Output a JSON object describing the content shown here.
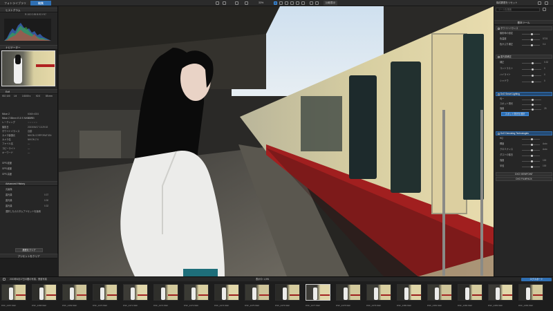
{
  "topbar": {
    "tab_library": "フォトライブラリ",
    "tab_edit": "編集",
    "zoom": "33%",
    "compare_label": "比較表示",
    "right_label": "構成履歴をリセット"
  },
  "left_panel": {
    "histogram": {
      "title": "ヒストグラム",
      "readout": "R:102 G:95 B:93 Y:97"
    },
    "navigator": {
      "title": "ナビゲーター",
      "zoom_label": "33%"
    },
    "exif": {
      "title": "Exif",
      "summary": [
        "ISO 100",
        "1/4",
        "1/1000 s",
        "f/2.0",
        "85 mm"
      ],
      "rows": [
        {
          "label": "Nikon Z",
          "value": "6048×4024"
        },
        {
          "label": "Nikon Z 85mm f/1.8 S NIKKOR",
          "value": "50 / 85"
        },
        {
          "label": "レーティング",
          "value": "☆☆☆☆☆"
        },
        {
          "label": "撮影日",
          "value": "2023/06/17 13:29:02"
        },
        {
          "label": "ホワイトバランス",
          "value": "自動"
        },
        {
          "label": "カメラ製造元",
          "value": "NIKON CORPORATION"
        },
        {
          "label": "カメラ名",
          "value": "NIKON Z 6"
        },
        {
          "label": "ファイル名",
          "value": "—"
        },
        {
          "label": "コピーライト",
          "value": "—"
        },
        {
          "label": "キーワード",
          "value": "—"
        }
      ],
      "gps": [
        {
          "label": "GPS 緯度",
          "value": ""
        },
        {
          "label": "GPS 経度",
          "value": ""
        },
        {
          "label": "GPS 高度",
          "value": ""
        }
      ]
    },
    "history": {
      "title": "Advanced History",
      "rows": [
        {
          "label": "元画像",
          "value": ""
        },
        {
          "label": "露光量",
          "value": "0.37"
        },
        {
          "label": "露光量",
          "value": "0.30"
        },
        {
          "label": "露光量",
          "value": "0.32"
        },
        {
          "label": "選択したカスタムプリセットを適用",
          "value": ""
        }
      ],
      "snapshot_button": "履歴をクリア",
      "footer": "プリセットをクリア"
    }
  },
  "right_panel": {
    "search_placeholder": "ツールを検索",
    "essentials_title": "基本ツール",
    "wb_title": "ホワイトバランス",
    "wb_rows": [
      {
        "label": "撮影時の設定",
        "value": ""
      },
      {
        "label": "色温度",
        "value": "5715"
      },
      {
        "label": "色かぶり補正",
        "value": "0.4"
      }
    ],
    "exposure_title": "露光量補正",
    "exposure_rows": [
      {
        "label": "補正",
        "value": "0.32"
      },
      {
        "label": "コントラスト",
        "value": "0"
      },
      {
        "label": "ハイライト",
        "value": "0"
      },
      {
        "label": "シャドウ",
        "value": "0"
      }
    ],
    "smart_lighting": "DxO Smart Lighting",
    "smart_rows": [
      {
        "label": "均一",
        "value": ""
      },
      {
        "label": "スポット測光",
        "value": ""
      },
      {
        "label": "強度",
        "value": "25"
      }
    ],
    "smart_button": "スポット測光を選択",
    "denoising": "DxO Denoising Technologies",
    "denoise_rows": [
      {
        "label": "HQ",
        "value": ""
      },
      {
        "label": "輝度",
        "value": "Auto"
      },
      {
        "label": "クロミナンス",
        "value": "Auto"
      },
      {
        "label": "ダストの除去",
        "value": ""
      },
      {
        "label": "強度",
        "value": "100"
      },
      {
        "label": "半径",
        "value": "100"
      }
    ],
    "viewpoint": "DXO VIEWPOINT",
    "filmpack": "DXO FILMPACK"
  },
  "filmstrip": {
    "path": "2023年6月17日の銀の写真、鉄道写真",
    "count": "表示中: 1,091",
    "export_label": "エクスポート",
    "selected_index": 10,
    "captions": [
      "DSF_2467.NEF",
      "DSF_2468.NEF",
      "DSF_2469.NEF",
      "DSF_2470.NEF",
      "DSF_2471.NEF",
      "DSF_2472.NEF",
      "DSF_2473.NEF",
      "DSF_2474.NEF",
      "DSF_2475.NEF",
      "DSF_2476.NEF",
      "DSF_2477.NEF",
      "DSF_2478.NEF",
      "DSF_2479.NEF",
      "DSF_2480.NEF",
      "DSF_2481.NEF",
      "DSF_2482.NEF",
      "DSF_2483.NEF",
      "DSF_2484.NEF"
    ]
  }
}
